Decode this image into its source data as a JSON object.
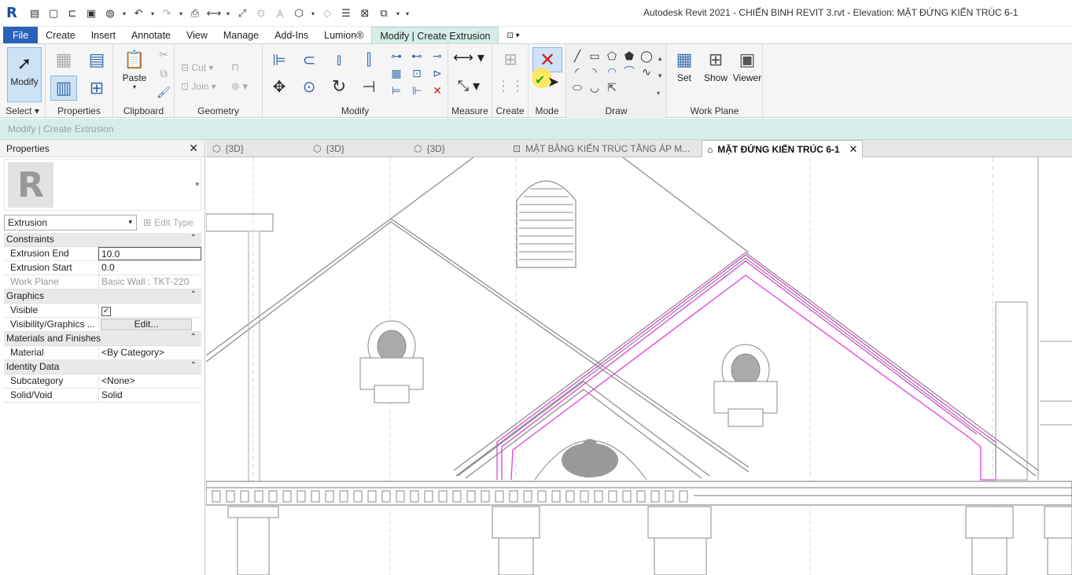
{
  "app": {
    "logo_letter": "R",
    "window_title": "Autodesk Revit 2021 - CHIẾN BINH REVIT 3.rvt - Elevation: MẶT ĐỨNG KIẾN TRÚC 6-1"
  },
  "ribbon_tabs": [
    {
      "label": "File"
    },
    {
      "label": "Create"
    },
    {
      "label": "Insert"
    },
    {
      "label": "Annotate"
    },
    {
      "label": "View"
    },
    {
      "label": "Manage"
    },
    {
      "label": "Add-Ins"
    },
    {
      "label": "Lumion®"
    },
    {
      "label": "Modify | Create Extrusion"
    }
  ],
  "ribbon": {
    "select": {
      "button": "Modify",
      "label": "Select ▾"
    },
    "properties": {
      "label": "Properties"
    },
    "clipboard": {
      "paste": "Paste",
      "label": "Clipboard"
    },
    "geometry": {
      "cut": "Cut",
      "join": "Join",
      "label": "Geometry"
    },
    "modify": {
      "label": "Modify"
    },
    "measure": {
      "label": "Measure"
    },
    "create": {
      "label": "Create"
    },
    "mode": {
      "label": "Mode"
    },
    "draw": {
      "label": "Draw"
    },
    "work_plane": {
      "set": "Set",
      "show": "Show",
      "viewer": "Viewer",
      "label": "Work Plane"
    }
  },
  "context_bar": "Modify | Create Extrusion",
  "properties": {
    "title": "Properties",
    "type_selector": "Extrusion",
    "edit_type": "Edit Type",
    "categories": [
      {
        "name": "Constraints",
        "rows": [
          {
            "key": "Extrusion End",
            "value": "10.0",
            "editing": true
          },
          {
            "key": "Extrusion Start",
            "value": "0.0"
          },
          {
            "key": "Work Plane",
            "value": "Basic Wall : TKT-220",
            "dim": true
          }
        ]
      },
      {
        "name": "Graphics",
        "rows": [
          {
            "key": "Visible",
            "value": "",
            "checkbox": true
          },
          {
            "key": "Visibility/Graphics ...",
            "value": "Edit...",
            "button": true
          }
        ]
      },
      {
        "name": "Materials and Finishes",
        "rows": [
          {
            "key": "Material",
            "value": "<By Category>"
          }
        ]
      },
      {
        "name": "Identity Data",
        "rows": [
          {
            "key": "Subcategory",
            "value": "<None>"
          },
          {
            "key": "Solid/Void",
            "value": "Solid"
          }
        ]
      }
    ]
  },
  "view_tabs": [
    {
      "label": "{3D}",
      "icon": "3d-view-icon"
    },
    {
      "label": "{3D}",
      "icon": "3d-view-icon"
    },
    {
      "label": "{3D}",
      "icon": "3d-view-icon"
    },
    {
      "label": "MẶT BẰNG KIẾN TRÚC TẦNG ÁP M...",
      "icon": "floor-plan-icon"
    },
    {
      "label": "MẶT ĐỨNG KIẾN TRÚC 6-1",
      "icon": "elevation-icon",
      "active": true
    }
  ],
  "colors": {
    "file_tab": "#2a62b8",
    "context_tab": "#d7ede9",
    "sketch_line": "#e040e0",
    "drawing_line": "#777777"
  }
}
